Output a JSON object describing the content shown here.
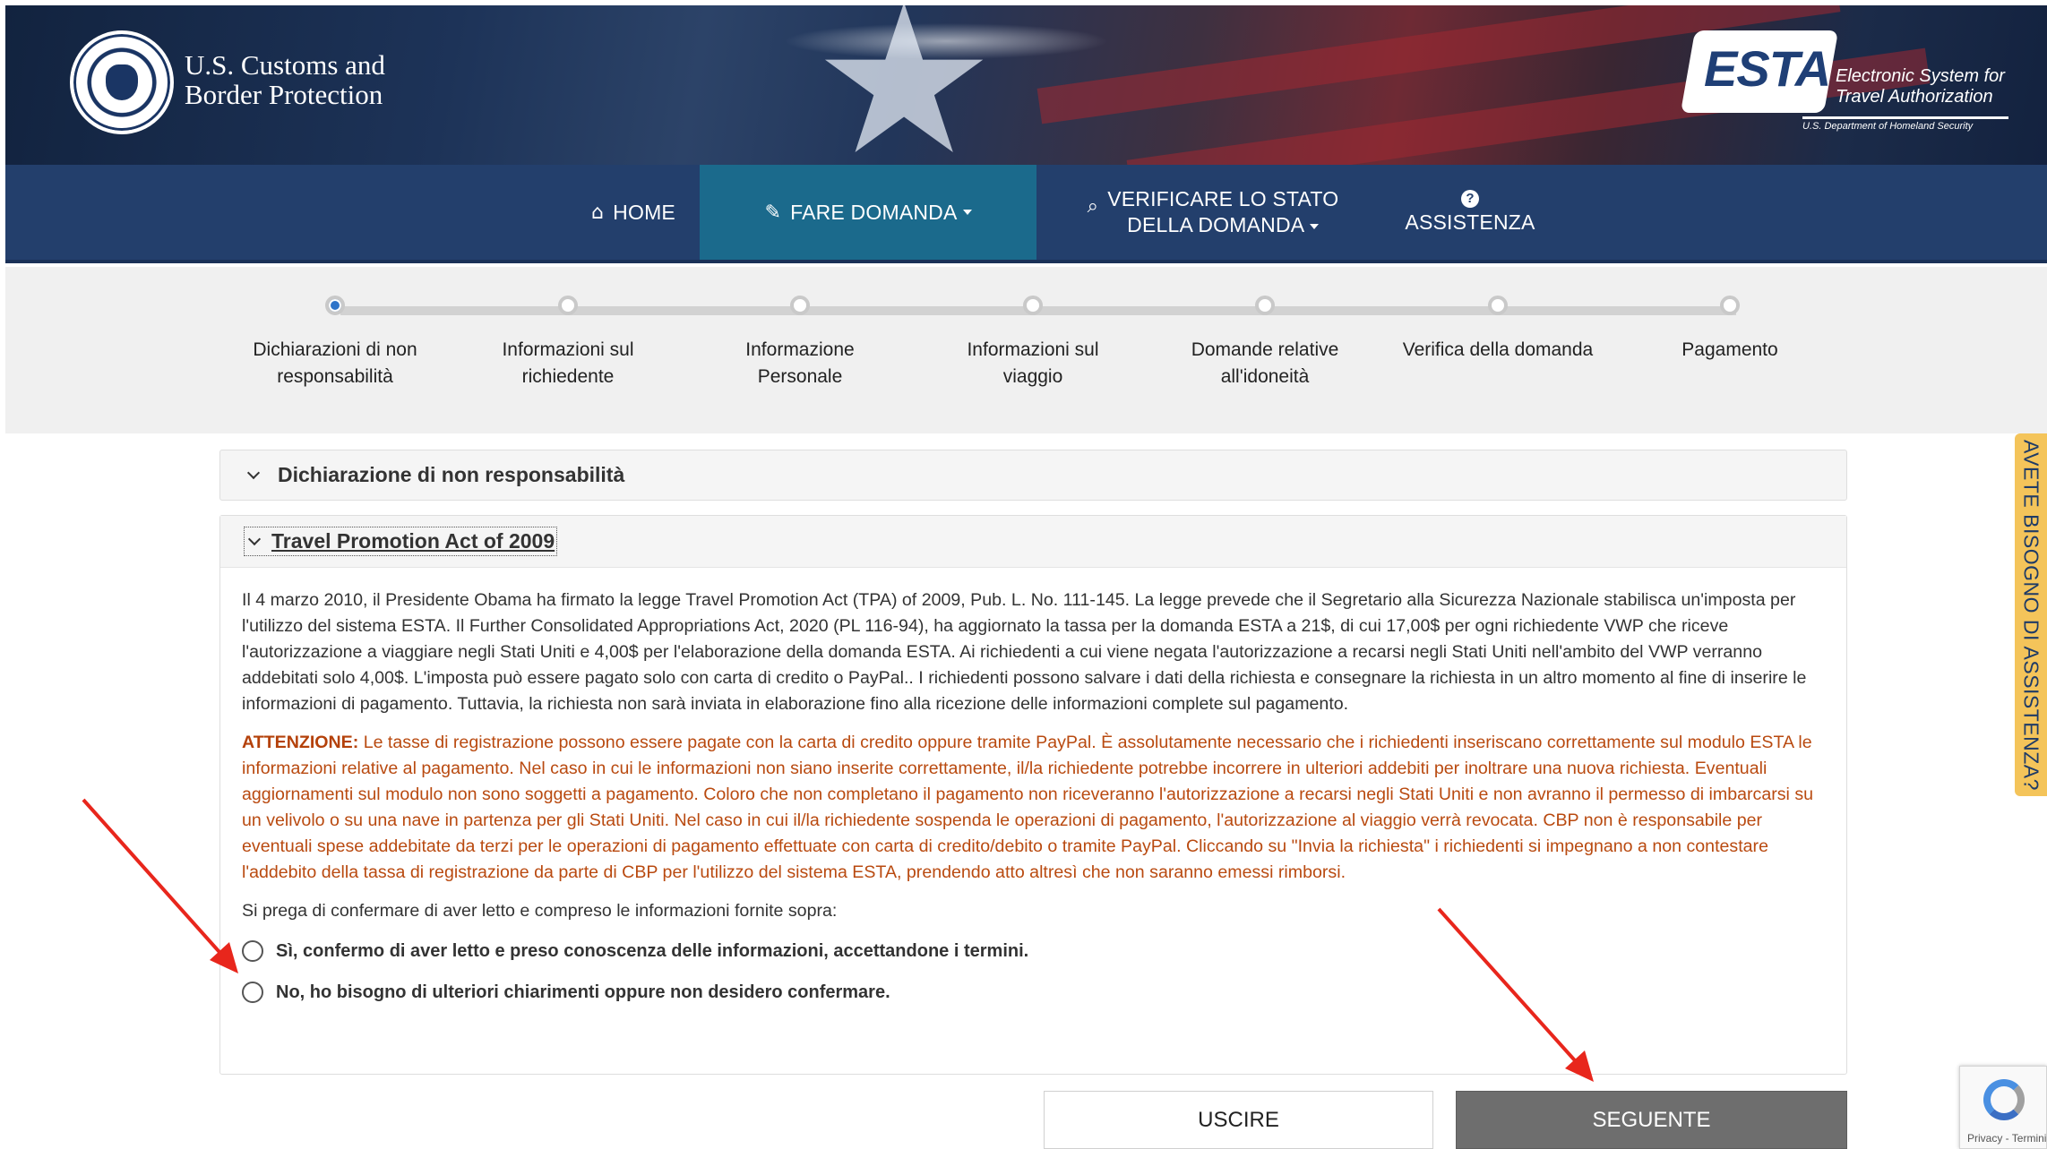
{
  "header": {
    "agency_name_line1": "U.S. Customs and",
    "agency_name_line2": "Border Protection",
    "esta_logo_text": "ESTA",
    "esta_subtitle_line1": "Electronic System for",
    "esta_subtitle_line2": "Travel Authorization",
    "esta_dept": "U.S. Department of Homeland Security"
  },
  "nav": {
    "home": {
      "label": "HOME",
      "icon": "home-icon"
    },
    "apply": {
      "label": "FARE DOMANDA",
      "icon": "pencil-icon"
    },
    "status": {
      "line1": "VERIFICARE LO STATO",
      "line2": "DELLA DOMANDA",
      "icon": "search-icon"
    },
    "help": {
      "label": "ASSISTENZA",
      "icon": "question-circle-icon"
    }
  },
  "steps": [
    {
      "line1": "Dichiarazioni di non",
      "line2": "responsabilità",
      "current": true
    },
    {
      "line1": "Informazioni sul",
      "line2": "richiedente",
      "current": false
    },
    {
      "line1": "Informazione",
      "line2": "Personale",
      "current": false
    },
    {
      "line1": "Informazioni sul",
      "line2": "viaggio",
      "current": false
    },
    {
      "line1": "Domande relative",
      "line2": "all'idoneità",
      "current": false
    },
    {
      "line1": "Verifica della domanda",
      "line2": "",
      "current": false
    },
    {
      "line1": "Pagamento",
      "line2": "",
      "current": false
    }
  ],
  "panels": {
    "disclaimer_title": "Dichiarazione di non responsabilità",
    "tpa_title": "Travel Promotion Act of 2009"
  },
  "content": {
    "paragraph": "Il 4 marzo 2010, il Presidente Obama ha firmato la legge Travel Promotion Act (TPA) of 2009, Pub. L. No. 111-145. La legge prevede che il Segretario alla Sicurezza Nazionale stabilisca un'imposta per l'utilizzo del sistema ESTA. Il Further Consolidated Appropriations Act, 2020 (PL 116-94), ha aggiornato la tassa per la domanda ESTA a 21$, di cui 17,00$ per ogni richiedente VWP che riceve l'autorizzazione a viaggiare negli Stati Uniti e 4,00$ per l'elaborazione della domanda ESTA. Ai richiedenti a cui viene negata l'autorizzazione a recarsi negli Stati Uniti nell'ambito del VWP verranno addebitati solo 4,00$. L'imposta può essere pagato solo con carta di credito o PayPal.. I richiedenti possono salvare i dati della richiesta e consegnare la richiesta in un altro momento al fine di inserire le informazioni di pagamento. Tuttavia, la richiesta non sarà inviata in elaborazione fino alla ricezione delle informazioni complete sul pagamento.",
    "warning_label": "ATTENZIONE:",
    "warning_text": " Le tasse di registrazione possono essere pagate con la carta di credito oppure tramite PayPal. È assolutamente necessario che i richiedenti inseriscano correttamente sul modulo ESTA le informazioni relative al pagamento. Nel caso in cui le informazioni non siano inserite correttamente, il/la richiedente potrebbe incorrere in ulteriori addebiti per inoltrare una nuova richiesta. Eventuali aggiornamenti sul modulo non sono soggetti a pagamento. Coloro che non completano il pagamento non riceveranno l'autorizzazione a recarsi negli Stati Uniti e non avranno il permesso di imbarcarsi su un velivolo o su una nave in partenza per gli Stati Uniti. Nel caso in cui il/la richiedente sospenda le operazioni di pagamento, l'autorizzazione al viaggio verrà revocata. CBP non è responsabile per eventuali spese addebitate da terzi per le operazioni di pagamento effettuate con carta di credito/debito o tramite PayPal. Cliccando su \"Invia la richiesta\" i richiedenti si impegnano a non contestare l'addebito della tassa di registrazione da parte di CBP per l'utilizzo del sistema ESTA, prendendo atto altresì che non saranno emessi rimborsi.",
    "confirm_question": "Si prega di confermare di aver letto e compreso le informazioni fornite sopra:",
    "option_yes": "Sì, confermo di aver letto e preso conoscenza delle informazioni, accettandone i termini.",
    "option_no": "No, ho bisogno di ulteriori chiarimenti oppure non desidero confermare."
  },
  "buttons": {
    "exit": "USCIRE",
    "next": "SEGUENTE"
  },
  "side_tab": "AVETE BISOGNO DI ASSISTENZA?",
  "recaptcha": "Privacy - Termini",
  "colors": {
    "nav_bg": "#233f6c",
    "nav_active": "#1b6a8c",
    "warning": "#b94a10",
    "next_button": "#6e6e6e",
    "help_tab": "#f4c45a",
    "arrow": "#e8261c"
  }
}
